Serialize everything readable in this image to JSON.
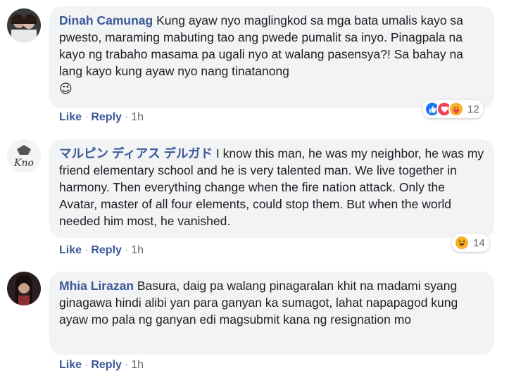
{
  "comments": [
    {
      "author": "Dinah Camunag",
      "text": "Kung ayaw nyo maglingkod sa mga bata umalis kayo sa pwesto, maraming mabuting tao ang pwede pumalit sa inyo. Pinagpala na kayo ng trabaho masama pa ugali nyo at walang pasensya?! Sa bahay na lang kayo kung ayaw nyo nang tinatanong",
      "emoji": "😉",
      "like": "Like",
      "reply": "Reply",
      "time": "1h",
      "reaction_icons": [
        "like-icon",
        "love-icon",
        "care-icon"
      ],
      "reaction_count": "12"
    },
    {
      "author": "マルピン ディアス デルガド",
      "text": "I know this man, he was my neighbor, he was my friend elementary school and he is very talented man. We live together in harmony. Then everything change when the fire nation attack. Only the Avatar, master of all four elements, could stop them. But when the world needed him most, he vanished.",
      "like": "Like",
      "reply": "Reply",
      "time": "1h",
      "reaction_icons": [
        "haha-icon"
      ],
      "reaction_count": "14"
    },
    {
      "author": "Mhia Lirazan",
      "text": "Basura, daig pa walang pinagaralan khit na madami syang ginagawa hindi alibi yan para ganyan ka sumagot, lahat napapagod kung ayaw mo pala ng ganyan edi magsubmit kana ng resignation mo",
      "like": "Like",
      "reply": "Reply",
      "time": "1h"
    }
  ],
  "colors": {
    "author": "#385898",
    "bubble": "#f2f3f5",
    "like": "#1877f2",
    "love": "#f33e58",
    "haha": "#f7b125"
  }
}
